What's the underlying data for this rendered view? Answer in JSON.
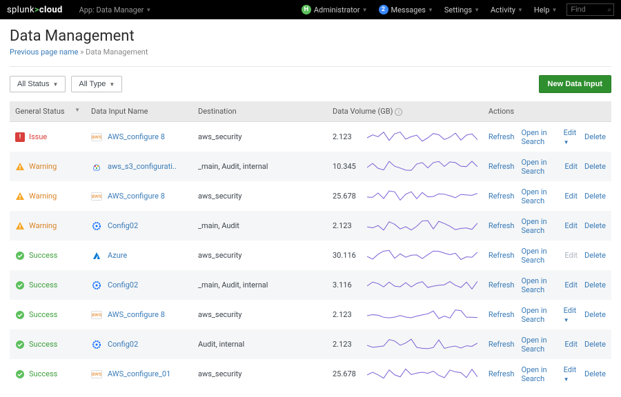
{
  "top": {
    "logo_pre": "splunk",
    "logo_post": "cloud",
    "app_label": "App: Data Manager",
    "admin_initial": "H",
    "admin": "Administrator",
    "msg_count": "2",
    "messages": "Messages",
    "settings": "Settings",
    "activity": "Activity",
    "help": "Help",
    "find_placeholder": "Find"
  },
  "page": {
    "title": "Data Management",
    "crumb_prev": "Previous page name",
    "crumb_sep": " » ",
    "crumb_cur": "Data Management"
  },
  "filters": {
    "status": "All Status",
    "type": "All Type"
  },
  "newbtn": "New Data Input",
  "cols": {
    "status": "General Status",
    "name": "Data Input Name",
    "dest": "Destination",
    "vol": "Data Volume (GB)",
    "actions": "Actions"
  },
  "act": {
    "refresh": "Refresh",
    "open": "Open in Search",
    "edit": "Edit",
    "delete": "Delete"
  },
  "rows": [
    {
      "status": "Issue",
      "st_type": "issue",
      "icon": "aws",
      "name": "AWS_configure 8",
      "dest": "aws_security",
      "vol": "2.123",
      "edit_caret": true,
      "edit_disabled": false
    },
    {
      "status": "Warning",
      "st_type": "warn",
      "icon": "gcp",
      "name": "aws_s3_configurati..",
      "dest": "_main, Audit, internal",
      "vol": "10.345",
      "edit_caret": false,
      "edit_disabled": false
    },
    {
      "status": "Warning",
      "st_type": "warn",
      "icon": "aws",
      "name": "AWS_configure 8",
      "dest": "aws_security",
      "vol": "25.678",
      "edit_caret": false,
      "edit_disabled": false
    },
    {
      "status": "Warning",
      "st_type": "warn",
      "icon": "cfg",
      "name": "Config02",
      "dest": "_main, Audit",
      "vol": "2.123",
      "edit_caret": false,
      "edit_disabled": false
    },
    {
      "status": "Success",
      "st_type": "succ",
      "icon": "az",
      "name": "Azure",
      "dest": "aws_security",
      "vol": "30.116",
      "edit_caret": false,
      "edit_disabled": true
    },
    {
      "status": "Success",
      "st_type": "succ",
      "icon": "cfg",
      "name": "Config02",
      "dest": "_main, Audit, internal",
      "vol": "3.116",
      "edit_caret": false,
      "edit_disabled": false
    },
    {
      "status": "Success",
      "st_type": "succ",
      "icon": "aws",
      "name": "AWS_configure 8",
      "dest": "aws_security",
      "vol": "2.123",
      "edit_caret": true,
      "edit_disabled": false
    },
    {
      "status": "Success",
      "st_type": "succ",
      "icon": "cfg",
      "name": "Config02",
      "dest": "Audit, internal",
      "vol": "2.123",
      "edit_caret": false,
      "edit_disabled": false
    },
    {
      "status": "Success",
      "st_type": "succ",
      "icon": "aws",
      "name": "AWS_configure_01",
      "dest": "aws_security",
      "vol": "25.678",
      "edit_caret": true,
      "edit_disabled": false
    }
  ],
  "chart_data": {
    "type": "sparkline",
    "note": "Sparkline shapes are decorative representations of volume trend per row; no numeric axis values are visible in the screenshot."
  }
}
